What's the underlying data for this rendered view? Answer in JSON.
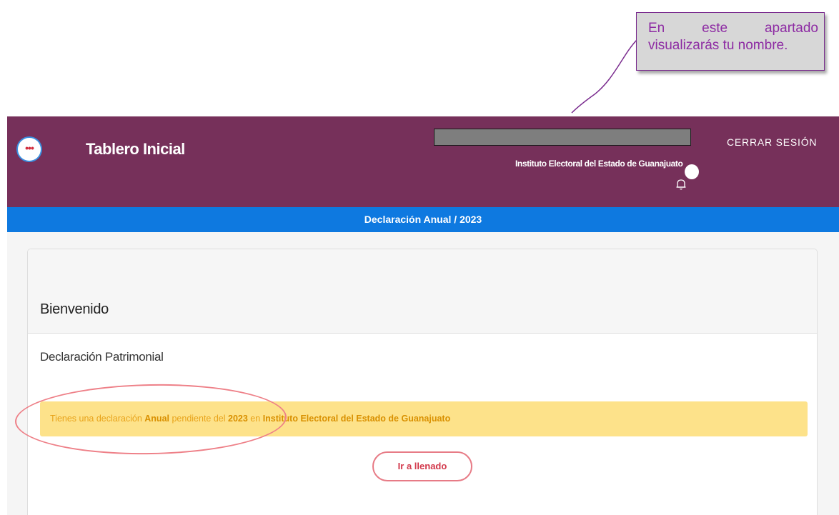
{
  "callout": {
    "line1": "En este apartado",
    "line2": "visualizarás tu nombre."
  },
  "header": {
    "menu_icon": "ellipsis-icon",
    "title": "Tablero Inicial",
    "institute": "Instituto Electoral del Estado de Guanajuato",
    "bell_icon": "bell-icon",
    "logout": "CERRAR SESIÓN"
  },
  "subbar": {
    "text": "Declaración Anual / 2023"
  },
  "card": {
    "welcome": "Bienvenido",
    "section_title": "Declaración Patrimonial",
    "alert": {
      "prefix": "Tienes una declaración ",
      "type": "Anual",
      "middle": " pendiente del ",
      "year": "2023",
      "connector": " en ",
      "institute": "Instituto Electoral del Estado de Guanajuato"
    },
    "button": "Ir a llenado"
  },
  "colors": {
    "header_bg": "#76305a",
    "subbar_bg": "#0e79e0",
    "alert_bg": "#fde28a",
    "alert_text": "#e8a31a",
    "button_border": "#e77b86",
    "callout_text": "#8d2ba3"
  }
}
